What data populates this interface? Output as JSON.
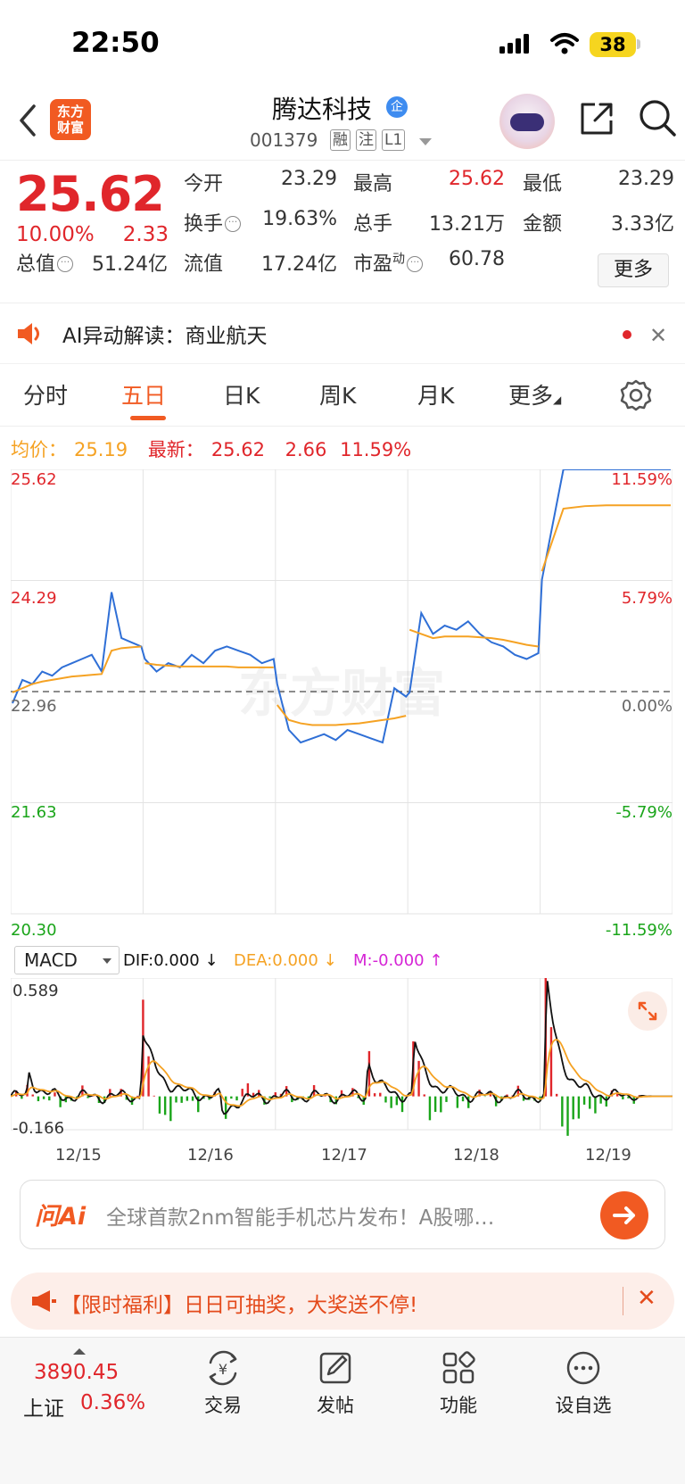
{
  "status_bar": {
    "time": "22:50",
    "battery": "38"
  },
  "header": {
    "logo_line1": "东方",
    "logo_line2": "财富",
    "stock_name": "腾达科技",
    "badge": "企",
    "stock_code": "001379",
    "tags": [
      "融",
      "注",
      "L1"
    ]
  },
  "quote": {
    "price": "25.62",
    "change_pct": "10.00%",
    "change": "2.33",
    "rows": [
      [
        {
          "label": "今开",
          "value": "23.29"
        },
        {
          "label": "最高",
          "value": "25.62"
        },
        {
          "label": "最低",
          "value": "23.29"
        }
      ],
      [
        {
          "label": "换手",
          "value": "19.63%"
        },
        {
          "label": "总手",
          "value": "13.21万"
        },
        {
          "label": "金额",
          "value": "3.33亿"
        }
      ],
      [
        {
          "label": "总值",
          "value": "51.24亿"
        },
        {
          "label": "流值",
          "value": "17.24亿"
        },
        {
          "label": "市盈",
          "sup": "动",
          "value": "60.78"
        }
      ]
    ],
    "more_label": "更多"
  },
  "ai_alert": {
    "text": "AI异动解读：商业航天"
  },
  "tabs": {
    "items": [
      "分时",
      "五日",
      "日K",
      "周K",
      "月K",
      "更多"
    ],
    "active": "五日"
  },
  "summary": {
    "avg_label": "均价：",
    "avg_value": "25.19",
    "latest_label": "最新：",
    "latest_value": "25.62",
    "latest_change": "2.66",
    "latest_pct": "11.59%"
  },
  "chart_data": [
    {
      "type": "line",
      "title": "",
      "x": [
        "12/15",
        "12/16",
        "12/17",
        "12/18",
        "12/19"
      ],
      "left_axis_ticks": [
        "25.62",
        "24.29",
        "22.96",
        "21.63",
        "20.30"
      ],
      "right_axis_ticks": [
        "11.59%",
        "5.79%",
        "0.00%",
        "-5.79%",
        "-11.59%"
      ],
      "ylim": [
        20.3,
        25.62
      ],
      "reference": 22.96,
      "watermark": "东方财富",
      "series": [
        {
          "name": "最新",
          "color": "#2f6fd6",
          "days": [
            [
              22.82,
              23.1,
              23.05,
              23.2,
              23.15,
              23.25,
              23.3,
              23.35,
              23.4,
              23.2,
              24.15,
              23.6,
              23.55,
              23.5
            ],
            [
              23.35,
              23.2,
              23.3,
              23.25,
              23.4,
              23.3,
              23.45,
              23.5,
              23.45,
              23.4,
              23.3,
              23.35
            ],
            [
              23.05,
              22.5,
              22.35,
              22.4,
              22.45,
              22.38,
              22.5,
              22.45,
              22.4,
              22.35,
              23.0,
              22.9
            ],
            [
              22.95,
              23.9,
              23.65,
              23.75,
              23.7,
              23.8,
              23.65,
              23.55,
              23.5,
              23.4,
              23.35,
              23.42
            ],
            [
              24.3,
              25.62,
              25.62,
              25.62,
              25.62,
              25.62,
              25.62
            ]
          ]
        },
        {
          "name": "均价",
          "color": "#f5a223",
          "days": [
            [
              22.95,
              23.0,
              23.05,
              23.08,
              23.1,
              23.12,
              23.14,
              23.15,
              23.16,
              23.17,
              23.45,
              23.48,
              23.49,
              23.5
            ],
            [
              23.3,
              23.28,
              23.27,
              23.26,
              23.26,
              23.26,
              23.26,
              23.26,
              23.25,
              23.25,
              23.25,
              23.25
            ],
            [
              22.8,
              22.62,
              22.58,
              22.56,
              22.56,
              22.56,
              22.57,
              22.58,
              22.6,
              22.62,
              22.64,
              22.67
            ],
            [
              23.7,
              23.65,
              23.6,
              23.62,
              23.62,
              23.62,
              23.61,
              23.6,
              23.58,
              23.55,
              23.52,
              23.5
            ],
            [
              24.4,
              25.15,
              25.18,
              25.19,
              25.19,
              25.19,
              25.19
            ]
          ]
        }
      ]
    },
    {
      "type": "line",
      "title": "",
      "indicator": "MACD",
      "x": [
        "12/15",
        "12/16",
        "12/17",
        "12/18",
        "12/19"
      ],
      "y_ticks": [
        "0.589",
        "-0.166"
      ],
      "ylim": [
        -0.166,
        0.589
      ],
      "series": [
        {
          "name": "DIF",
          "label": "DIF:0.000",
          "color": "#111111"
        },
        {
          "name": "DEA",
          "label": "DEA:0.000",
          "color": "#f5a223"
        },
        {
          "name": "M",
          "label": "M:-0.000",
          "color": "#d524d5"
        }
      ],
      "arrows": {
        "dif": "↓",
        "dea": "↓",
        "m": "↑"
      }
    }
  ],
  "ask_ai": {
    "logo": "问Ai",
    "placeholder": "全球首款2nm智能手机芯片发布！A股哪…"
  },
  "promo": {
    "text": "【限时福利】日日可抽奖，大奖送不停!"
  },
  "bottom_bar": {
    "index_value": "3890.45",
    "index_name": "上证",
    "index_pct": "0.36%",
    "items": [
      {
        "label": "交易",
        "icon": "trade-icon"
      },
      {
        "label": "发帖",
        "icon": "post-icon"
      },
      {
        "label": "功能",
        "icon": "function-icon"
      },
      {
        "label": "设自选",
        "icon": "add-watchlist-icon"
      }
    ]
  }
}
